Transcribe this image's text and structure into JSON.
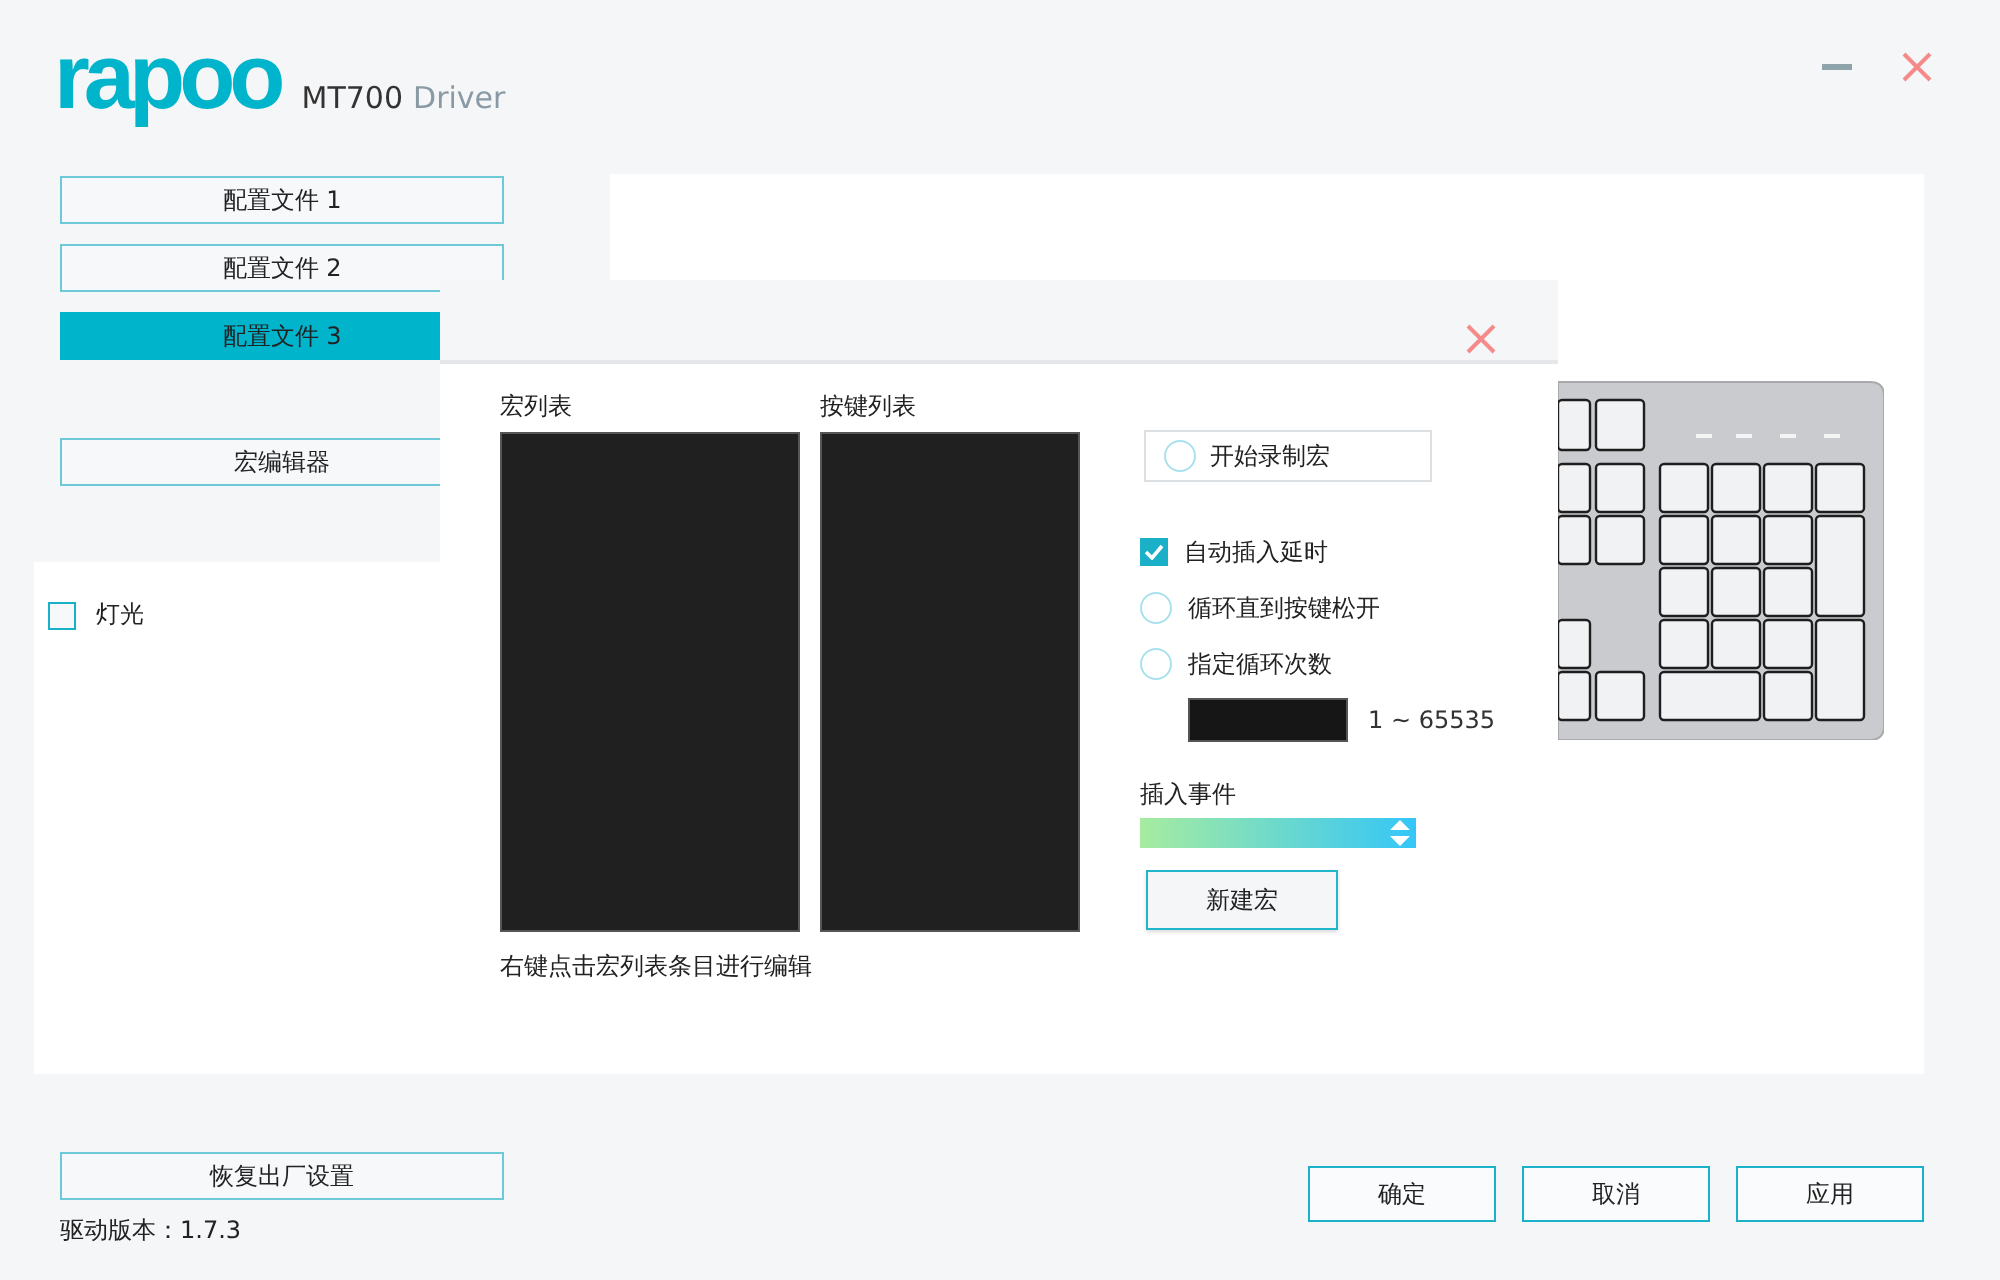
{
  "header": {
    "logo": "rapoo",
    "model": "MT700",
    "product": "Driver"
  },
  "profiles": [
    {
      "label": "配置文件 1",
      "selected": false
    },
    {
      "label": "配置文件 2",
      "selected": false
    },
    {
      "label": "配置文件 3",
      "selected": true
    }
  ],
  "macro_editor_button": {
    "label": "宏编辑器"
  },
  "lighting": {
    "label": "灯光",
    "checked": false
  },
  "macro_dialog": {
    "macro_list": {
      "label": "宏列表"
    },
    "key_list": {
      "label": "按键列表"
    },
    "hint": "右键点击宏列表条目进行编辑",
    "record_button": {
      "label": "开始录制宏",
      "recording": false
    },
    "options": [
      {
        "kind": "checkbox",
        "label": "自动插入延时",
        "checked": true
      },
      {
        "kind": "radio",
        "label": "循环直到按键松开",
        "selected": false
      },
      {
        "kind": "radio",
        "label": "指定循环次数",
        "selected": false
      }
    ],
    "repeat_count": {
      "range": "1 ~ 65535"
    },
    "insert_event": {
      "label": "插入事件"
    },
    "new_macro_button": {
      "label": "新建宏"
    }
  },
  "reset_button": {
    "label": "恢复出厂设置"
  },
  "version": "驱动版本：1.7.3",
  "footer_buttons": [
    {
      "label": "确定"
    },
    {
      "label": "取消"
    },
    {
      "label": "应用"
    }
  ]
}
